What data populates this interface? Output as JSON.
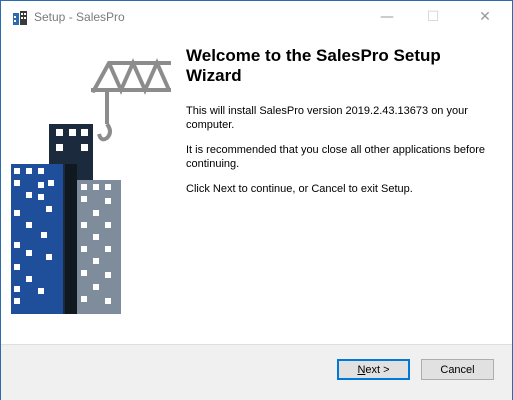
{
  "window": {
    "title": "Setup - SalesPro",
    "controls": {
      "minimize": "—",
      "maximize": "☐",
      "close": "✕"
    }
  },
  "icons": {
    "app": "setup-app-icon",
    "illustration": "building-crane-illustration"
  },
  "content": {
    "heading": "Welcome to the SalesPro Setup Wizard",
    "paragraph1": "This will install SalesPro version 2019.2.43.13673 on your computer.",
    "paragraph2": "It is recommended that you close all other applications before continuing.",
    "paragraph3": "Click Next to continue, or Cancel to exit Setup."
  },
  "buttons": {
    "next_mnemonic": "N",
    "next_rest": "ext >",
    "cancel": "Cancel"
  },
  "colors": {
    "accent": "#0078d7",
    "building_blue": "#1f4e9a",
    "building_dark": "#1c2a3e",
    "building_gray": "#7f8c9b",
    "crane": "#8c8c8c"
  }
}
